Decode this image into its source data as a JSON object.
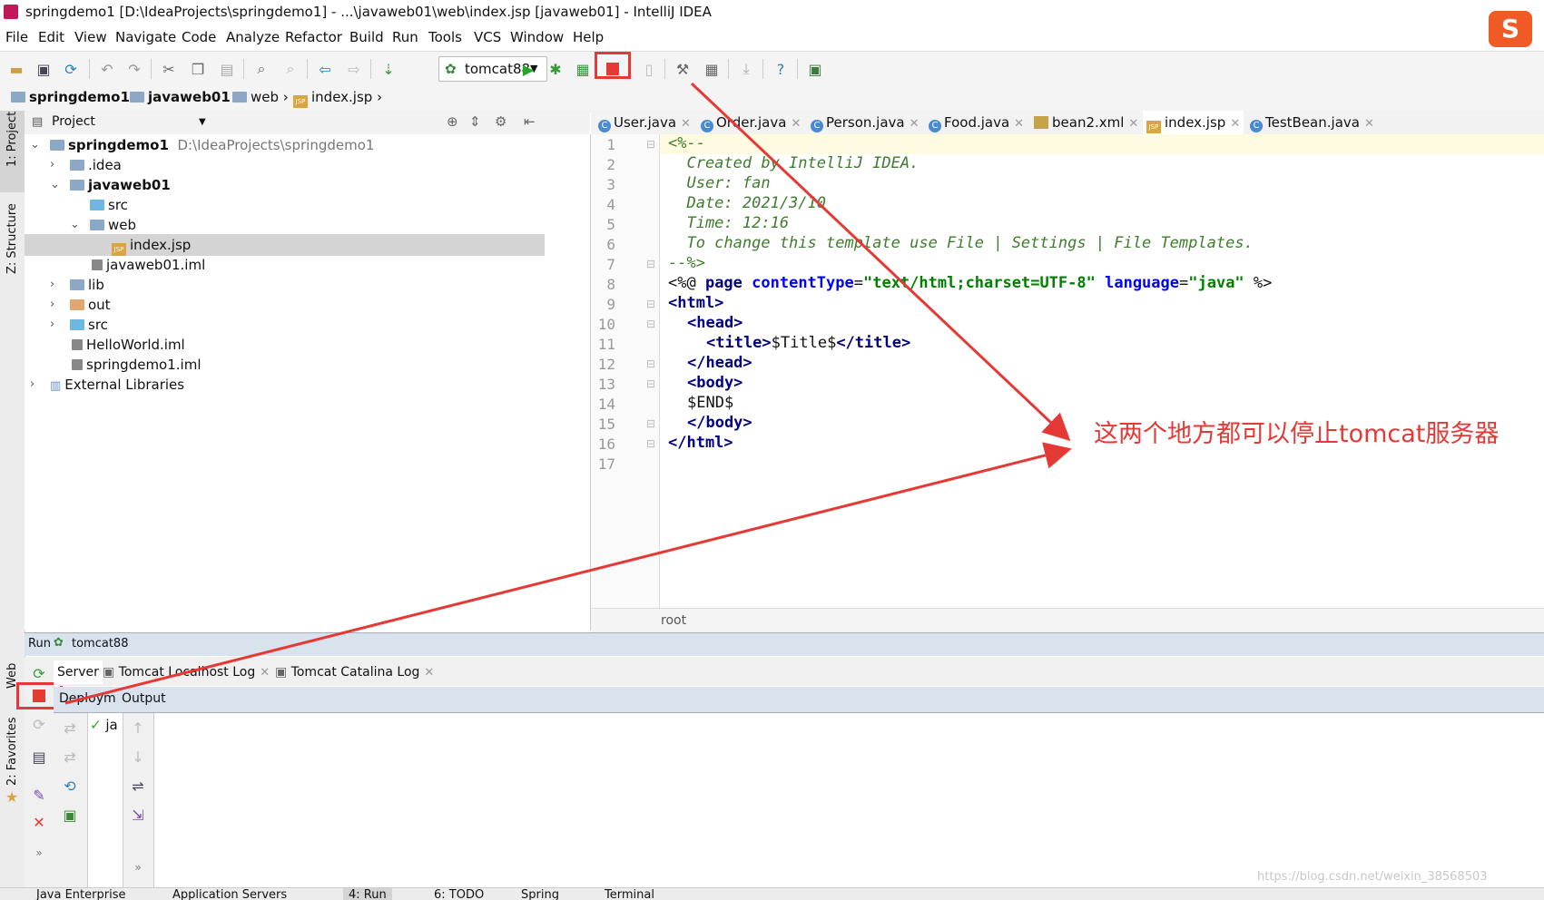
{
  "window": {
    "title": "springdemo1 [D:\\IdeaProjects\\springdemo1] - ...\\javaweb01\\web\\index.jsp [javaweb01] - IntelliJ IDEA"
  },
  "sogou_badge": "S",
  "menu": [
    "File",
    "Edit",
    "View",
    "Navigate",
    "Code",
    "Analyze",
    "Refactor",
    "Build",
    "Run",
    "Tools",
    "VCS",
    "Window",
    "Help"
  ],
  "toolbar": {
    "run_config": "tomcat88",
    "stop_color": "#e53935"
  },
  "breadcrumbs": [
    "springdemo1",
    "javaweb01",
    "web",
    "index.jsp"
  ],
  "project": {
    "header": "Project",
    "tree": [
      {
        "label": "springdemo1",
        "path": "D:\\IdeaProjects\\springdemo1"
      },
      {
        "label": ".idea"
      },
      {
        "label": "javaweb01"
      },
      {
        "label": "src"
      },
      {
        "label": "web"
      },
      {
        "label": "index.jsp"
      },
      {
        "label": "javaweb01.iml"
      },
      {
        "label": "lib"
      },
      {
        "label": "out"
      },
      {
        "label": "src"
      },
      {
        "label": "HelloWorld.iml"
      },
      {
        "label": "springdemo1.iml"
      },
      {
        "label": "External Libraries"
      }
    ]
  },
  "side_labels": {
    "project": "1: Project",
    "structure": "Z: Structure",
    "web": "Web",
    "favorites": "2: Favorites"
  },
  "editor": {
    "tabs": [
      "User.java",
      "Order.java",
      "Person.java",
      "Food.java",
      "bean2.xml",
      "index.jsp",
      "TestBean.java"
    ],
    "active_tab": "index.jsp",
    "line_numbers": [
      "1",
      "2",
      "3",
      "4",
      "5",
      "6",
      "7",
      "8",
      "9",
      "10",
      "11",
      "12",
      "13",
      "14",
      "15",
      "16",
      "17"
    ],
    "breadcrumb": "root",
    "code": {
      "l1": "<%--",
      "l2": "  Created by IntelliJ IDEA.",
      "l3": "  User: fan",
      "l4": "  Date: 2021/3/10",
      "l5": "  Time: 12:16",
      "l6": "  To change this template use File | Settings | File Templates.",
      "l7": "--%>",
      "l8_open": "<%@ ",
      "l8_page": "page ",
      "l8_ct": "contentType",
      "l8_eq1": "=",
      "l8_ctv": "\"text/html;charset=UTF-8\"",
      "l8_sp": " ",
      "l8_lang": "language",
      "l8_eq2": "=",
      "l8_langv": "\"java\"",
      "l8_close": " %>",
      "l9": "<html>",
      "l10": "<head>",
      "l11_o": "<title>",
      "l11_t": "$Title$",
      "l11_c": "</title>",
      "l12": "</head>",
      "l13": "<body>",
      "l14": "$END$",
      "l15": "</body>",
      "l16": "</html>"
    }
  },
  "run_panel": {
    "label": "Run",
    "config": "tomcat88",
    "tabs": [
      "Server",
      "Tomcat Localhost Log",
      "Tomcat Catalina Log"
    ],
    "deploy_header": "Deploym",
    "output_header": "Output",
    "deployment_item": "ja"
  },
  "bottom_bar": [
    "Java Enterprise",
    "Application Servers",
    "4: Run",
    "6: TODO",
    "Spring",
    "Terminal"
  ],
  "annotation": "这两个地方都可以停止tomcat服务器",
  "watermark": "https://blog.csdn.net/weixin_38568503"
}
